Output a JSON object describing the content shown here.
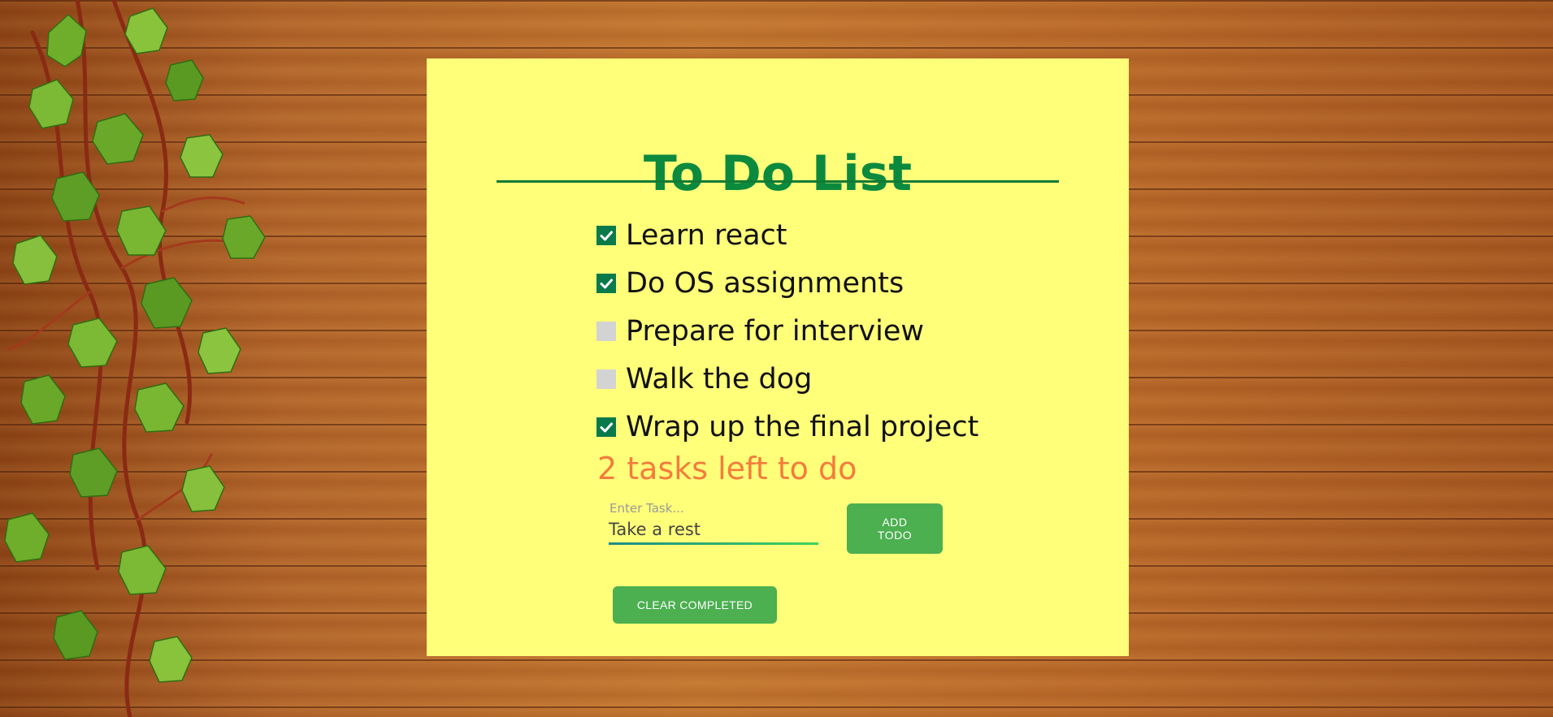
{
  "app": {
    "title": "To Do List"
  },
  "todos": [
    {
      "label": "Learn react",
      "checked": true
    },
    {
      "label": "Do OS assignments",
      "checked": true
    },
    {
      "label": "Prepare for interview",
      "checked": false
    },
    {
      "label": "Walk the dog",
      "checked": false
    },
    {
      "label": "Wrap up the final project",
      "checked": true
    }
  ],
  "summary": {
    "remaining_text": "2 tasks left to do"
  },
  "task_input": {
    "label": "Enter Task...",
    "value": "Take a rest"
  },
  "buttons": {
    "add_label": "ADD TODO",
    "clear_label": "CLEAR COMPLETED"
  },
  "icons": {
    "checked": "checkbox-checked-icon",
    "unchecked": "checkbox-unchecked-icon"
  },
  "colors": {
    "card_background": "#ffff7a",
    "title": "#0b8a3e",
    "checkbox_checked": "#0a7a4a",
    "checkbox_unchecked": "#d3d3d3",
    "remaining_text": "#f47c3c",
    "button": "#4caf50"
  }
}
